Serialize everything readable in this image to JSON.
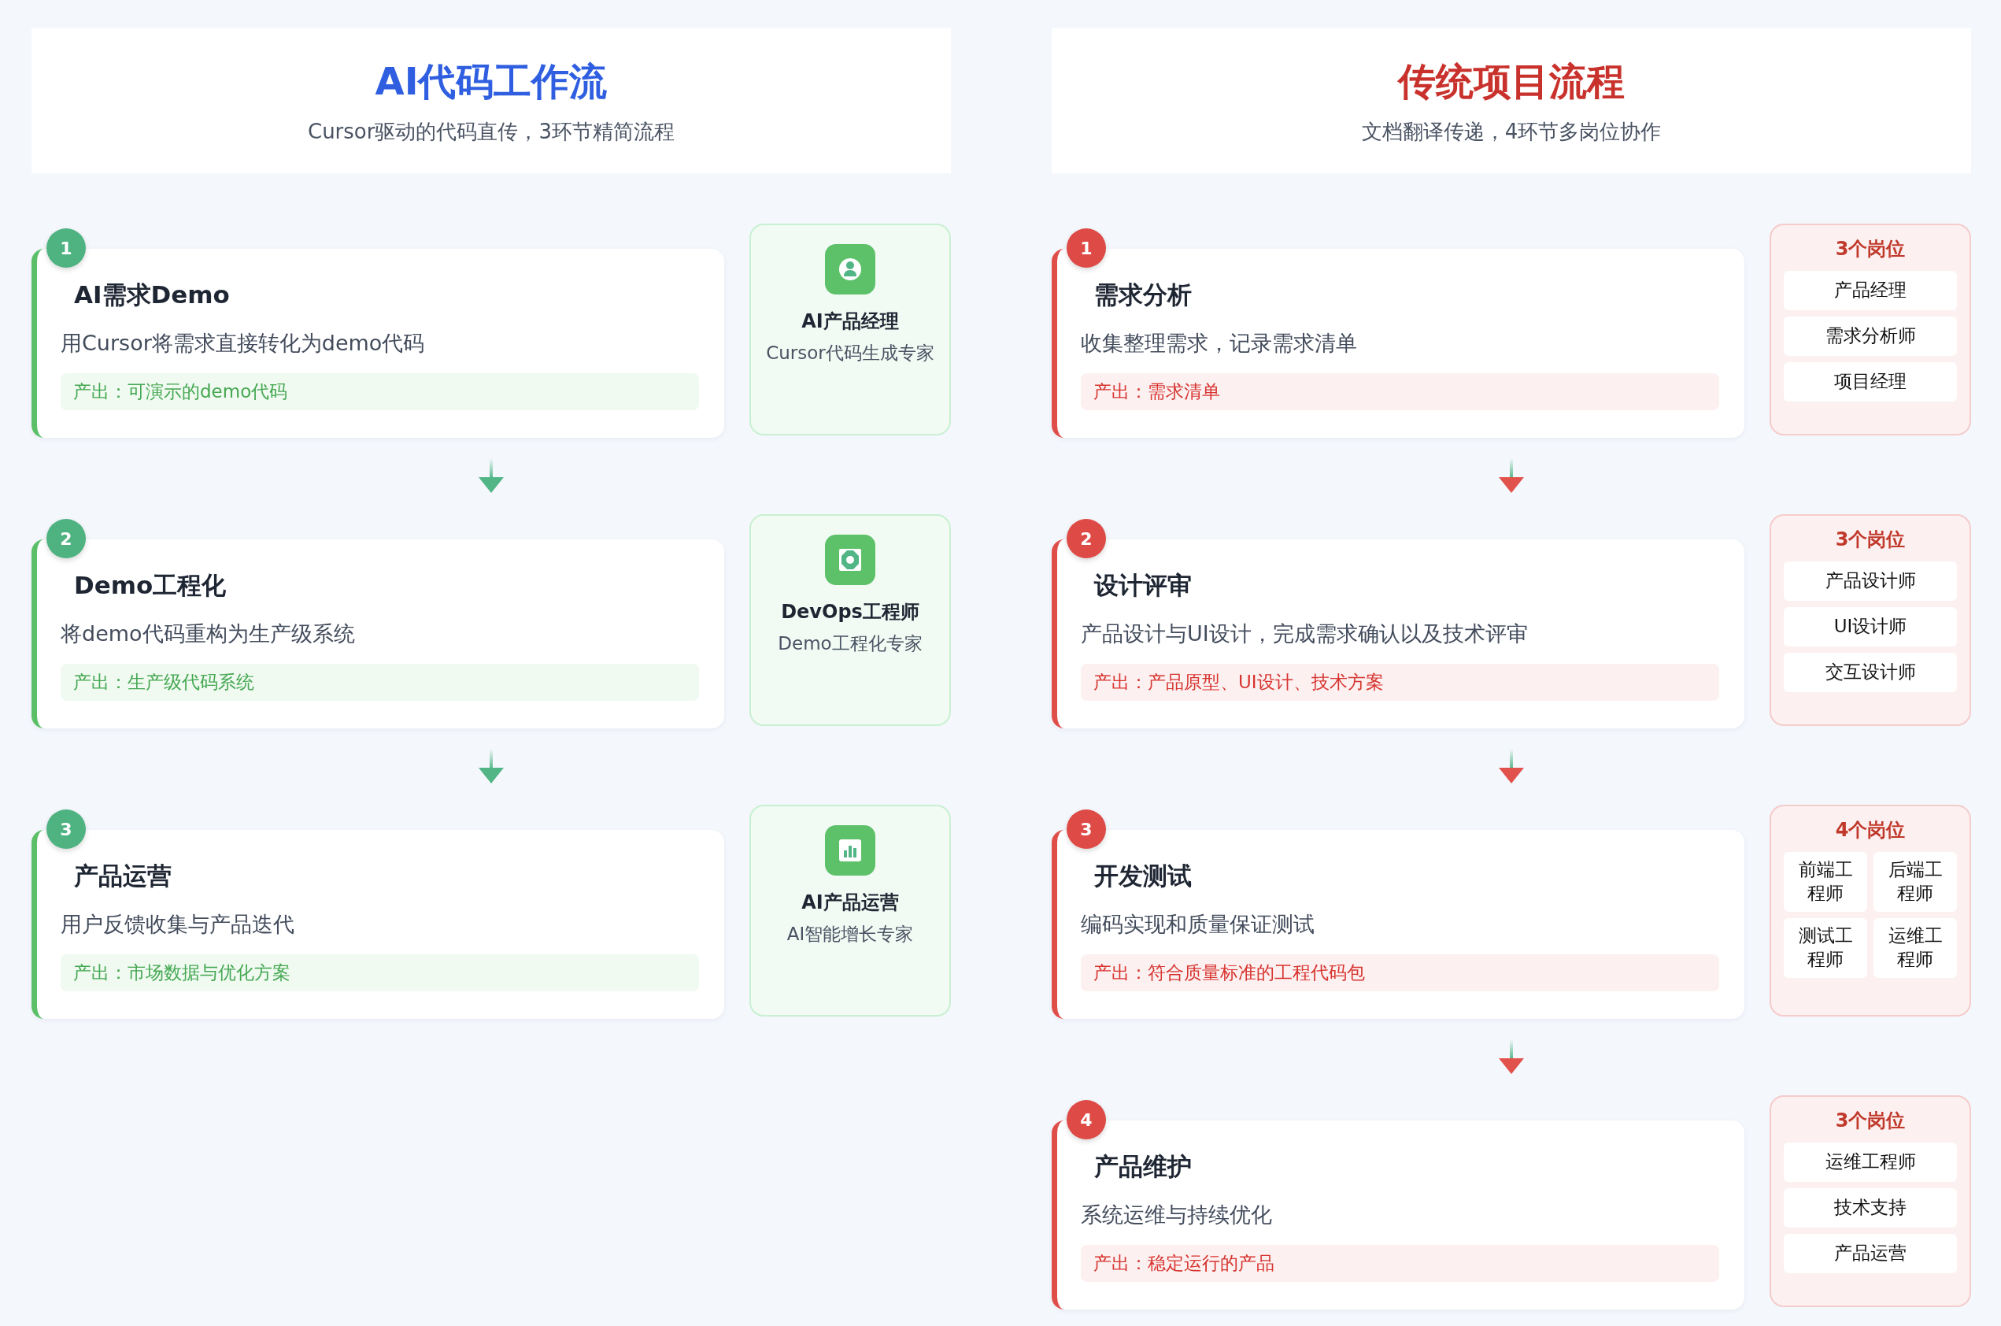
{
  "columns": [
    {
      "title": "AI代码工作流",
      "subtitle": "Cursor驱动的代码直传，3环节精简流程",
      "steps": [
        {
          "number": "1",
          "title": "AI需求Demo",
          "description": "用Cursor将需求直接转化为demo代码",
          "output": "产出：可演示的demo代码",
          "side": {
            "kind": "expert",
            "name": "AI产品经理",
            "role": "Cursor代码生成专家"
          }
        },
        {
          "number": "2",
          "title": "Demo工程化",
          "description": "将demo代码重构为生产级系统",
          "output": "产出：生产级代码系统",
          "side": {
            "kind": "expert",
            "name": "DevOps工程师",
            "role": "Demo工程化专家"
          }
        },
        {
          "number": "3",
          "title": "产品运营",
          "description": "用户反馈收集与产品迭代",
          "output": "产出：市场数据与优化方案",
          "side": {
            "kind": "expert",
            "name": "AI产品运营",
            "role": "AI智能增长专家"
          }
        }
      ]
    },
    {
      "title": "传统项目流程",
      "subtitle": "文档翻译传递，4环节多岗位协作",
      "steps": [
        {
          "number": "1",
          "title": "需求分析",
          "description": "收集整理需求，记录需求清单",
          "output": "产出：需求清单",
          "side": {
            "kind": "roles-list",
            "count": "3个岗位",
            "roles": [
              "产品经理",
              "需求分析师",
              "项目经理"
            ]
          }
        },
        {
          "number": "2",
          "title": "设计评审",
          "description": "产品设计与UI设计，完成需求确认以及技术评审",
          "output": "产出：产品原型、UI设计、技术方案",
          "side": {
            "kind": "roles-list",
            "count": "3个岗位",
            "roles": [
              "产品设计师",
              "UI设计师",
              "交互设计师"
            ]
          }
        },
        {
          "number": "3",
          "title": "开发测试",
          "description": "编码实现和质量保证测试",
          "output": "产出：符合质量标准的工程代码包",
          "side": {
            "kind": "roles-grid",
            "count": "4个岗位",
            "roles": [
              "前端工程师",
              "后端工程师",
              "测试工程师",
              "运维工程师"
            ]
          }
        },
        {
          "number": "4",
          "title": "产品维护",
          "description": "系统运维与持续优化",
          "output": "产出：稳定运行的产品",
          "side": {
            "kind": "roles-list",
            "count": "3个岗位",
            "roles": [
              "运维工程师",
              "技术支持",
              "产品运营"
            ]
          }
        }
      ]
    }
  ]
}
